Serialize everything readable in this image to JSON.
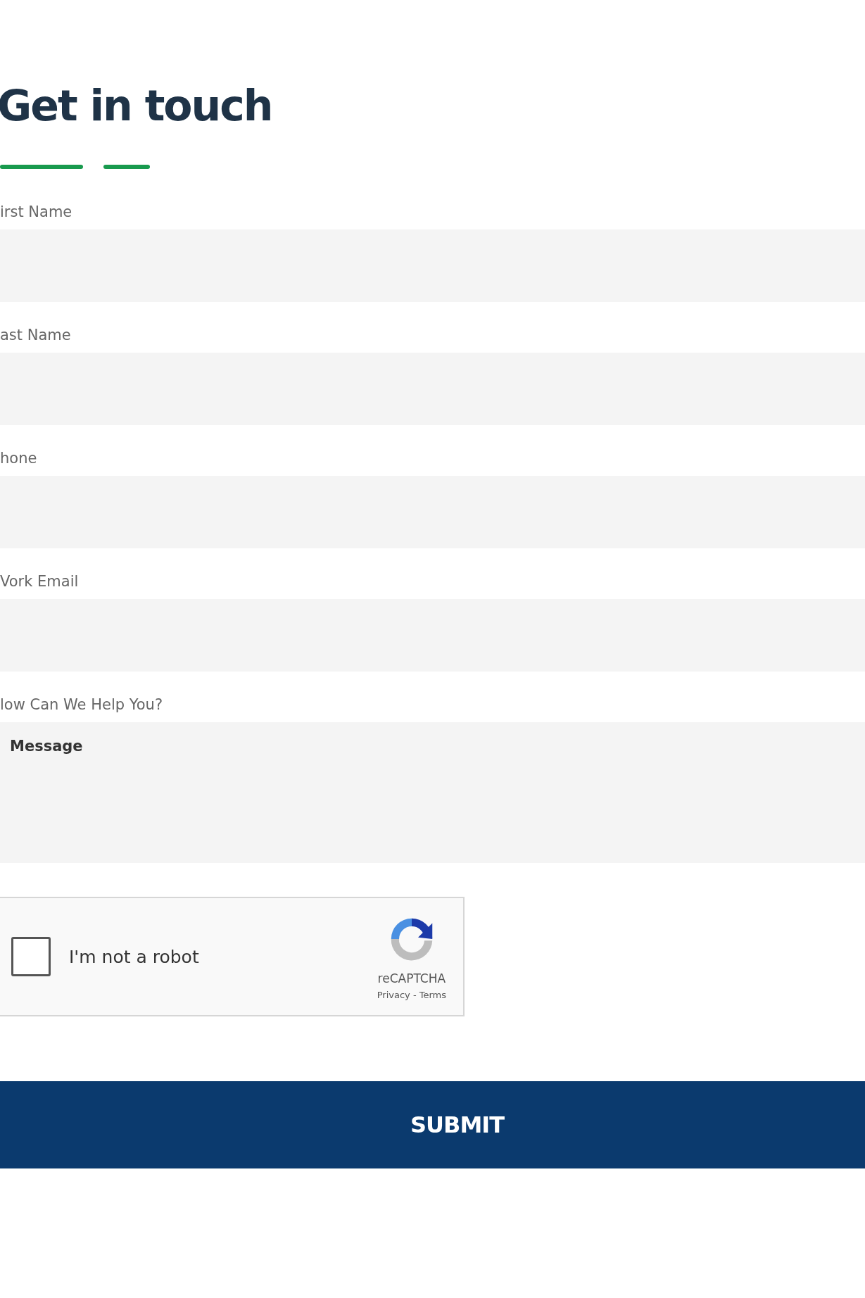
{
  "heading": "Get in touch",
  "fields": [
    {
      "kind": "input",
      "label": "irst Name"
    },
    {
      "kind": "input",
      "label": "ast Name"
    },
    {
      "kind": "input",
      "label": "hone"
    },
    {
      "kind": "input",
      "label": "Vork Email"
    },
    {
      "kind": "textarea",
      "label": "low Can We Help You?",
      "placeholder": "Message"
    }
  ],
  "captcha": {
    "label": "I'm not a robot",
    "checked": false,
    "brand": "reCAPTCHA",
    "links": "Privacy - Terms"
  },
  "submit": "SUBMIT"
}
